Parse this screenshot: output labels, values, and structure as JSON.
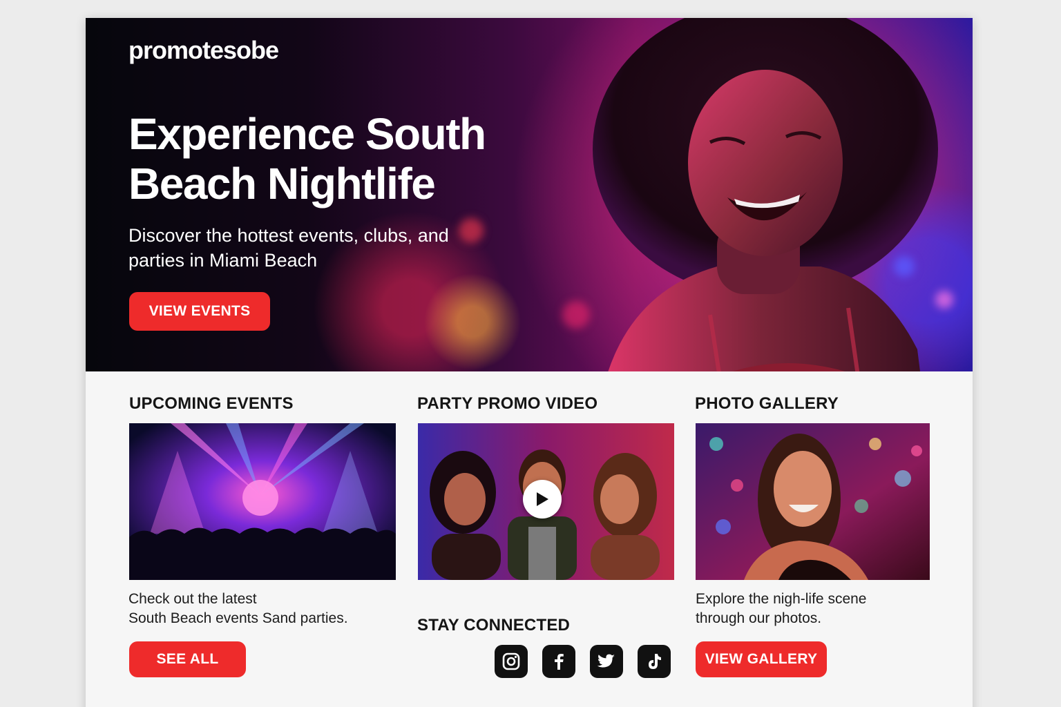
{
  "brand": {
    "logo": "promotesobe"
  },
  "hero": {
    "title": "Experience South Beach Nightlife",
    "subtitle": "Discover the hottest events, clubs, and parties in Miami Beach",
    "cta_label": "VIEW EVENTS"
  },
  "events": {
    "title": "UPCOMING EVENTS",
    "description_line1": "Check out the latest",
    "description_line2": "South Beach events Sand parties.",
    "button_label": "SEE ALL"
  },
  "video": {
    "title": "PARTY PROMO VIDEO"
  },
  "social": {
    "title": "STAY CONNECTED",
    "icons": [
      "instagram-icon",
      "facebook-icon",
      "twitter-icon",
      "tiktok-icon"
    ]
  },
  "gallery": {
    "title": "PHOTO GALLERY",
    "description_line1": "Explore the nigh-life scene",
    "description_line2": "through our photos.",
    "button_label": "VIEW GALLERY"
  },
  "colors": {
    "accent": "#ee2b2b",
    "background": "#f6f6f6",
    "hero_dark": "#06060c",
    "hero_magenta": "#6b0e5c",
    "hero_blue": "#2a1aa0"
  }
}
